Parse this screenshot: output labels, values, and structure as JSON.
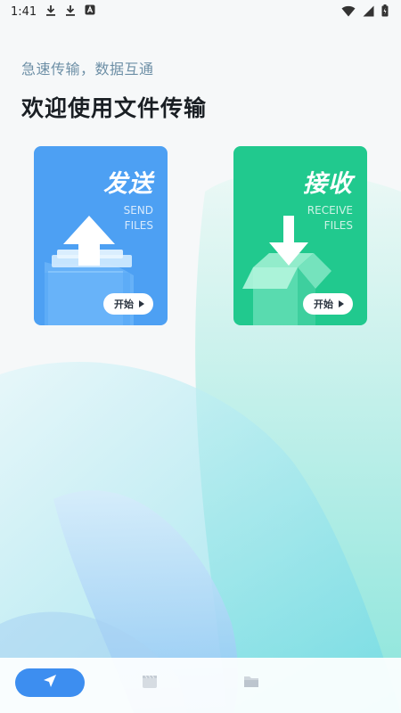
{
  "status_bar": {
    "time": "1:41",
    "left_icons": [
      "download-icon",
      "download-icon",
      "text-a-icon"
    ],
    "right_icons": [
      "wifi-icon",
      "signal-icon",
      "battery-charging-icon"
    ]
  },
  "header": {
    "subtitle": "急速传输，数据互通",
    "title": "欢迎使用文件传输"
  },
  "cards": [
    {
      "id": "send",
      "title": "发送",
      "en_line1": "SEND",
      "en_line2": "FILES",
      "button": "开始",
      "color": "#4da0f3",
      "icon": "upload-arrow-icon"
    },
    {
      "id": "receive",
      "title": "接收",
      "en_line1": "RECEIVE",
      "en_line2": "FILES",
      "button": "开始",
      "color": "#21c98e",
      "icon": "download-box-icon"
    }
  ],
  "bottom_nav": {
    "items": [
      {
        "icon": "send-plane-icon",
        "active": true
      },
      {
        "icon": "clapperboard-icon",
        "active": false
      },
      {
        "icon": "folder-icon",
        "active": false
      }
    ],
    "active_color": "#3d8ef0"
  }
}
